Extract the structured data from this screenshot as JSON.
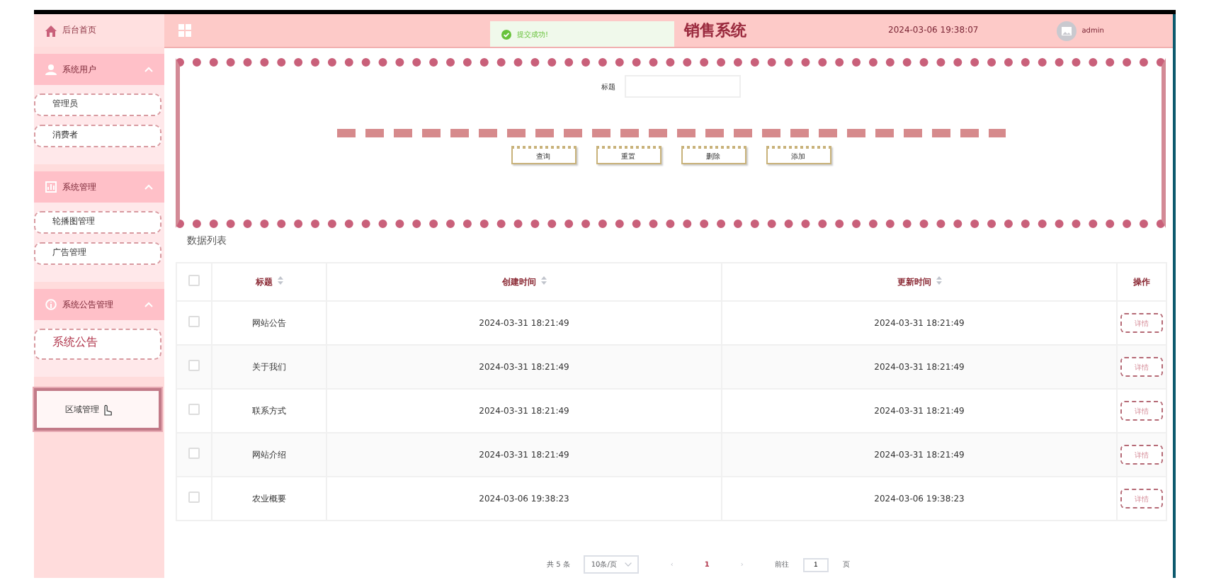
{
  "header": {
    "home": "后台首页",
    "title": "销售系统",
    "datetime": "2024-03-06 19:38:07",
    "user": "admin"
  },
  "toast": {
    "text": "提交成功!"
  },
  "sidebar": {
    "groups": [
      {
        "label": "系统用户",
        "expanded": true,
        "items": [
          {
            "label": "管理员",
            "selected": false
          },
          {
            "label": "消费者",
            "selected": false
          }
        ]
      },
      {
        "label": "系统管理",
        "expanded": true,
        "items": [
          {
            "label": "轮播图管理",
            "selected": false
          },
          {
            "label": "广告管理",
            "selected": false
          }
        ]
      },
      {
        "label": "系统公告管理",
        "expanded": true,
        "items": [
          {
            "label": "系统公告",
            "selected": false
          }
        ]
      }
    ],
    "extra": [
      {
        "label": "区域管理",
        "selected": true
      }
    ]
  },
  "search": {
    "label": "标题",
    "buttons": [
      "查询",
      "重置",
      "删除",
      "添加"
    ]
  },
  "table": {
    "caption": "数据列表",
    "all_checked": false,
    "columns": [
      "标题",
      "创建时间",
      "更新时间",
      "操作"
    ],
    "rows": [
      {
        "title": "网站公告",
        "created": "2024-03-31 18:21:49",
        "updated": "2024-03-31 18:21:49",
        "action": "详情",
        "checked": false
      },
      {
        "title": "关于我们",
        "created": "2024-03-31 18:21:49",
        "updated": "2024-03-31 18:21:49",
        "action": "详情",
        "checked": false
      },
      {
        "title": "联系方式",
        "created": "2024-03-31 18:21:49",
        "updated": "2024-03-31 18:21:49",
        "action": "详情",
        "checked": false
      },
      {
        "title": "网站介绍",
        "created": "2024-03-31 18:21:49",
        "updated": "2024-03-31 18:21:49",
        "action": "详情",
        "checked": false
      },
      {
        "title": "农业概要",
        "created": "2024-03-06 19:38:23",
        "updated": "2024-03-06 19:38:23",
        "action": "详情",
        "checked": false
      }
    ]
  },
  "pagination": {
    "total": "共 5 条",
    "size": "10条/页",
    "prev": "‹",
    "page": "1",
    "next": "›",
    "goto": "前往",
    "goto_value": "1",
    "unit": "页"
  }
}
